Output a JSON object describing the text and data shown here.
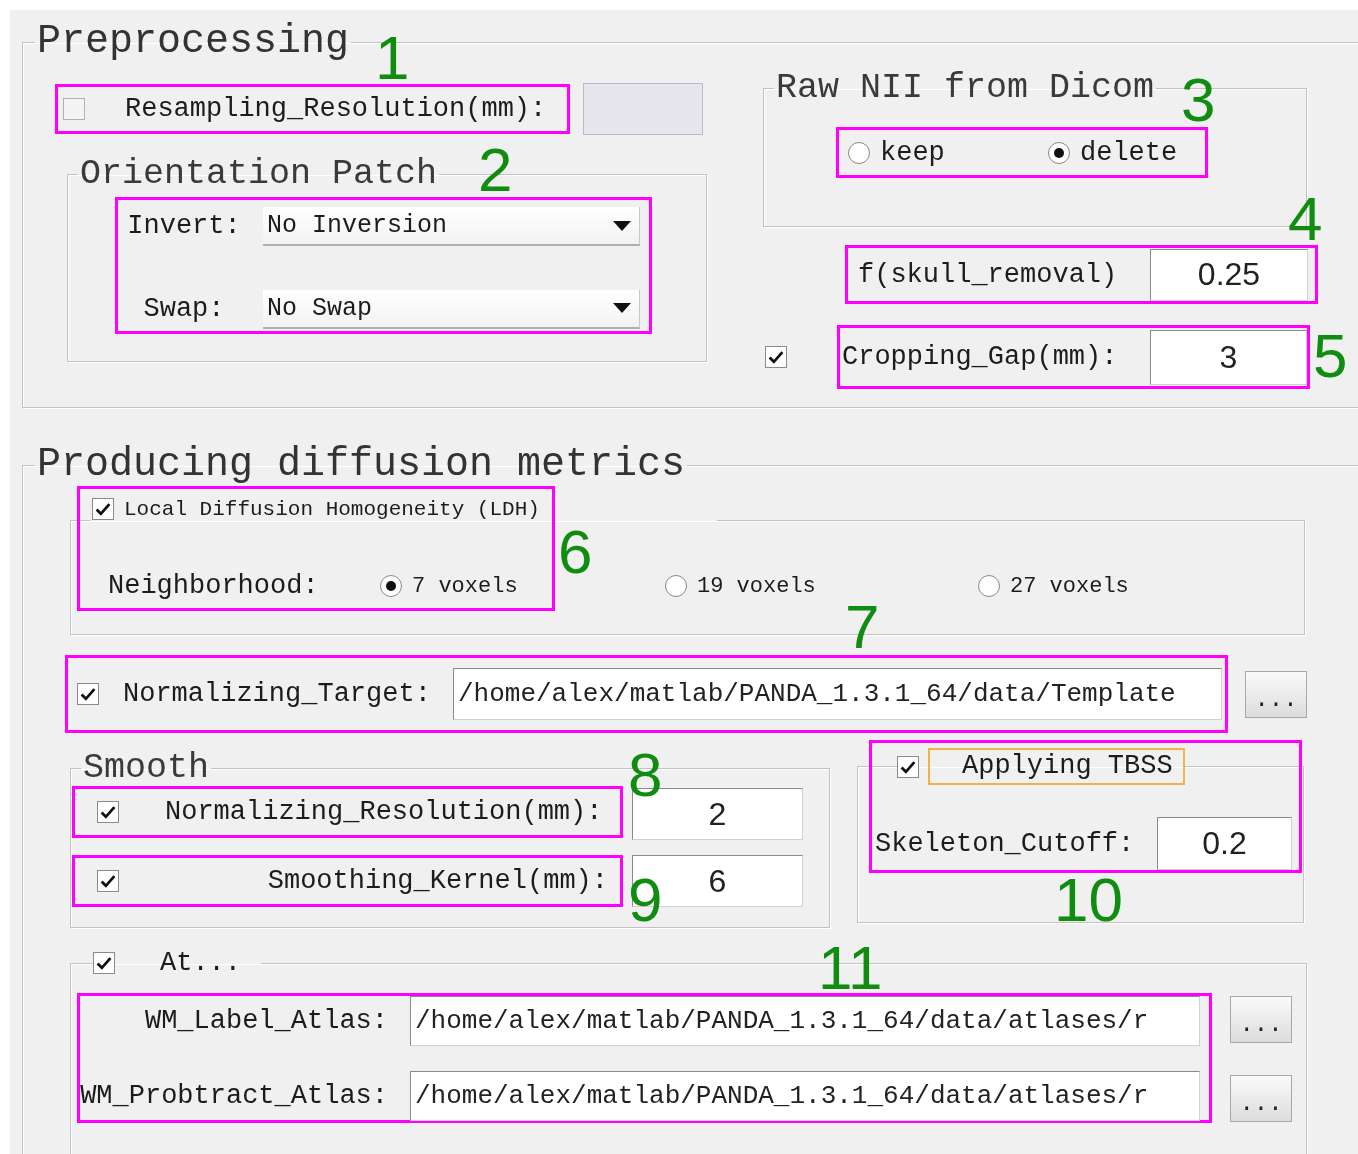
{
  "preprocessing": {
    "title": "Preprocessing",
    "resampling": {
      "label": "Resampling_Resolution(mm):",
      "checked": false,
      "field_disabled": true
    },
    "orientation_patch": {
      "title": "Orientation Patch",
      "invert": {
        "label": "Invert:",
        "value": "No Inversion"
      },
      "swap": {
        "label": "Swap:",
        "value": "No Swap"
      }
    },
    "raw_nii": {
      "title": "Raw NII from Dicom",
      "options": [
        {
          "label": "keep",
          "selected": false
        },
        {
          "label": "delete",
          "selected": true
        }
      ]
    },
    "skull_removal": {
      "label": "f(skull_removal)",
      "value": "0.25"
    },
    "cropping_gap": {
      "label": "Cropping_Gap(mm):",
      "value": "3",
      "checked": true
    }
  },
  "diffusion_metrics": {
    "title": "Producing diffusion metrics",
    "ldh": {
      "label": "Local Diffusion Homogeneity (LDH)",
      "checked": true,
      "neighborhood_label": "Neighborhood:",
      "options": [
        {
          "label": "7 voxels",
          "selected": true
        },
        {
          "label": "19 voxels",
          "selected": false
        },
        {
          "label": "27 voxels",
          "selected": false
        }
      ]
    },
    "normalizing_target": {
      "label": "Normalizing_Target:",
      "checked": true,
      "value": "/home/alex/matlab/PANDA_1.3.1_64/data/Template",
      "browse": "..."
    },
    "smooth": {
      "title": "Smooth",
      "rows": [
        {
          "label": "Normalizing_Resolution(mm):",
          "checked": true,
          "value": "2"
        },
        {
          "label": "Smoothing_Kernel(mm):",
          "checked": true,
          "value": "6"
        }
      ]
    },
    "tbss": {
      "label": "Applying TBSS",
      "checked": true,
      "focused": true,
      "cutoff_label": "Skeleton_Cutoff:",
      "value": "0.2"
    },
    "atlas": {
      "label": "At...",
      "checked": true,
      "rows": [
        {
          "label": "WM_Label_Atlas:",
          "value": "/home/alex/matlab/PANDA_1.3.1_64/data/atlases/r",
          "browse": "..."
        },
        {
          "label": "WM_Probtract_Atlas:",
          "value": "/home/alex/matlab/PANDA_1.3.1_64/data/atlases/r",
          "browse": "..."
        }
      ]
    }
  },
  "annotations": [
    {
      "label": "1"
    },
    {
      "label": "2"
    },
    {
      "label": "3"
    },
    {
      "label": "4"
    },
    {
      "label": "5"
    },
    {
      "label": "6"
    },
    {
      "label": "7"
    },
    {
      "label": "8"
    },
    {
      "label": "9"
    },
    {
      "label": "10"
    },
    {
      "label": "11"
    }
  ]
}
